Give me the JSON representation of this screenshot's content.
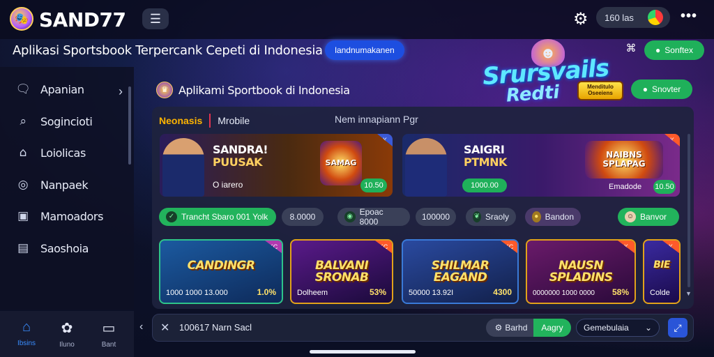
{
  "header": {
    "brand": "SAND77",
    "balance": "160 las",
    "tagline": "Aplikasi Sportsbook Terpercank Cepeti di Indonesia",
    "tagline_button": "landnumakanen"
  },
  "sidebar": {
    "items": [
      {
        "label": "Apanian",
        "icon": "chat-icon"
      },
      {
        "label": "Sogincioti",
        "icon": "search-icon"
      },
      {
        "label": "Loiolicas",
        "icon": "tag-icon"
      },
      {
        "label": "Nanpaek",
        "icon": "globe-icon"
      },
      {
        "label": "Mamoadors",
        "icon": "document-icon"
      },
      {
        "label": "Saoshoia",
        "icon": "folder-icon"
      }
    ]
  },
  "bottom_nav": [
    {
      "label": "Ibsins",
      "icon": "home-icon"
    },
    {
      "label": "Iluno",
      "icon": "apps-icon"
    },
    {
      "label": "Bant",
      "icon": "cart-icon"
    }
  ],
  "hero": {
    "title": "Srursvails",
    "subtitle": "Redti",
    "badge": "Menditulo Oseeiens",
    "button_1": "Sonftex",
    "button_2": "Snovter"
  },
  "section": {
    "title": "Aplikami Sportbook di Indonesia"
  },
  "panel": {
    "tab_active": "Neonasis",
    "tab_2": "Mrobile",
    "hint": "Nem innapiann Pgr"
  },
  "banners": [
    {
      "title_1": "SANDRA!",
      "title_2": "PUUSAK",
      "sub": "O iarero",
      "badge": "10.50",
      "graphic": "SAMAG",
      "corner": "K"
    },
    {
      "title_1": "SAIGRI",
      "title_2": "PTMNK",
      "sub": "1000.00",
      "badge": "10.50",
      "graphic": "NAIBNS SPLAPAG",
      "tag": "Emadode",
      "corner": "K"
    }
  ],
  "chips": [
    {
      "label": "Trancht Sbaro 001 Yolk",
      "icon": "check-icon"
    },
    {
      "label": "8.0000"
    },
    {
      "label": "Epoac 8000",
      "icon": "ball-icon"
    },
    {
      "label": "100000"
    },
    {
      "label": "Sraoly",
      "icon": "leaf-icon"
    },
    {
      "label": "Bandon",
      "icon": "coin-icon"
    },
    {
      "label": "Banvor",
      "icon": "avatar-icon"
    }
  ],
  "cards": [
    {
      "title": "CANDINGR",
      "meta": "1000 1000 13.000",
      "pct": "1.0%",
      "corner": "KC"
    },
    {
      "title": "BALVANI SRONAB",
      "meta": "Dolheem",
      "pct": "53%",
      "corner": "KC"
    },
    {
      "title": "SHILMAR EAGAND",
      "meta": "50000 13.92I",
      "pct": "4300",
      "corner": "KC"
    },
    {
      "title": "NAUSN SPLADINS",
      "meta": "0000000 1000 0000",
      "pct": "58%",
      "corner": "K"
    },
    {
      "title": "BIE",
      "meta": "Colde",
      "pct": "",
      "corner": "K"
    }
  ],
  "bottombar": {
    "text": "100617 Narn Sacl",
    "button_1": "Barhd",
    "button_2": "Aagry",
    "select": "Gemebulaia"
  },
  "colors": {
    "accent_green": "#22b35c",
    "accent_blue": "#1d4ee0",
    "accent_orange": "#ffb400",
    "panel_bg": "#1e233e"
  }
}
